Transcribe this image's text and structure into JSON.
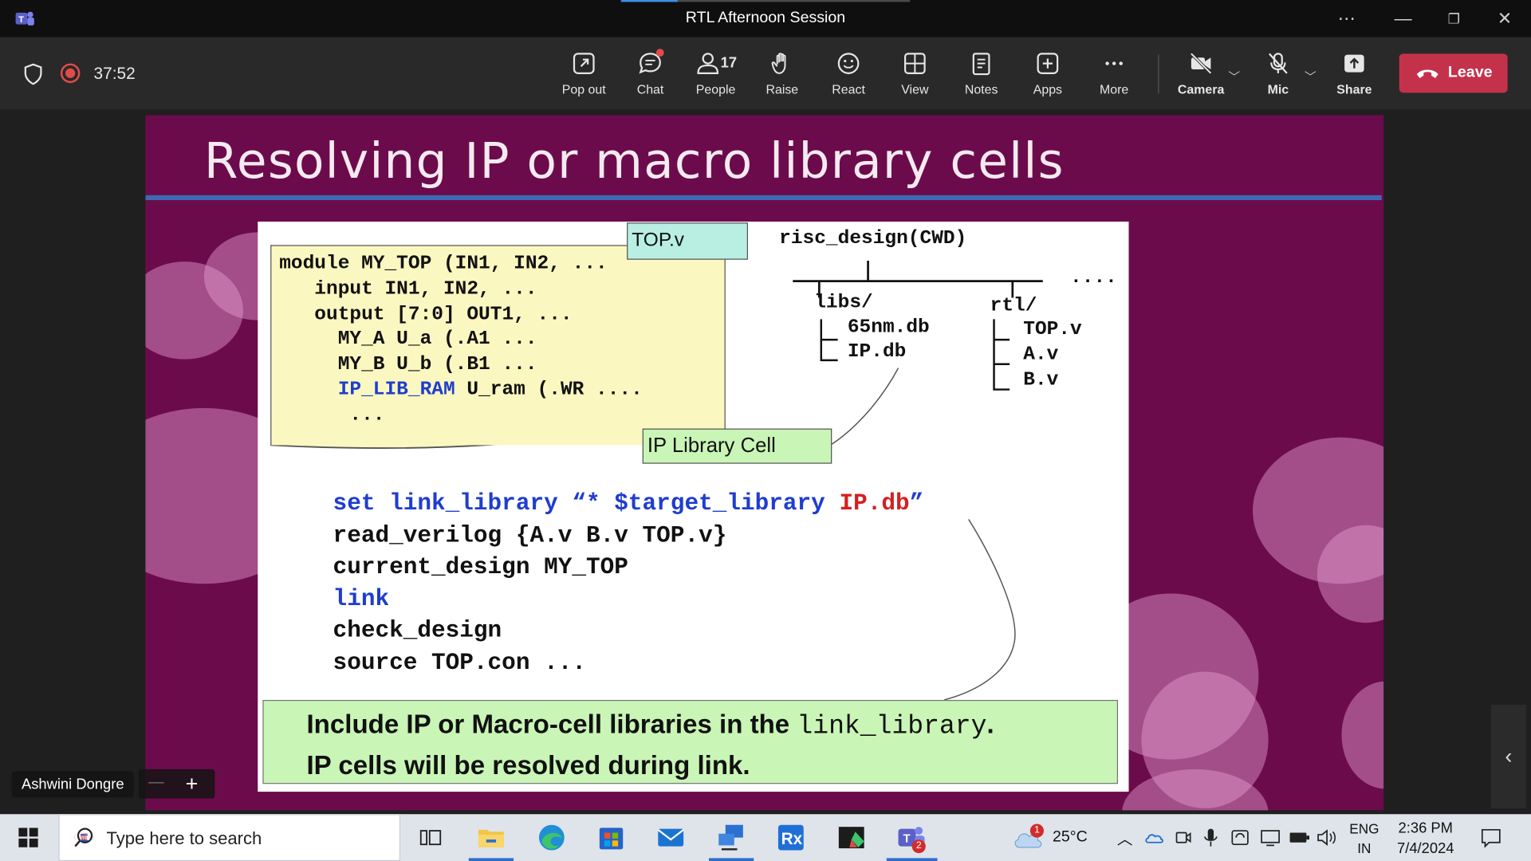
{
  "window": {
    "title": "RTL Afternoon Session"
  },
  "toolbar": {
    "timer": "37:52",
    "buttons": [
      {
        "label": "Pop out",
        "icon": "pop-out-icon"
      },
      {
        "label": "Chat",
        "icon": "chat-icon"
      },
      {
        "label": "People",
        "icon": "people-icon",
        "count": "17"
      },
      {
        "label": "Raise",
        "icon": "raise-hand-icon"
      },
      {
        "label": "React",
        "icon": "react-icon"
      },
      {
        "label": "View",
        "icon": "view-icon"
      },
      {
        "label": "Notes",
        "icon": "notes-icon"
      },
      {
        "label": "Apps",
        "icon": "apps-icon"
      },
      {
        "label": "More",
        "icon": "more-icon"
      },
      {
        "label": "Camera",
        "icon": "camera-off-icon"
      },
      {
        "label": "Mic",
        "icon": "mic-off-icon"
      },
      {
        "label": "Share",
        "icon": "share-icon"
      }
    ],
    "leave_label": "Leave",
    "leave_color": "#c4314b"
  },
  "slide": {
    "title": "Resolving IP or macro library cells",
    "file_label": "TOP.v",
    "code": {
      "l1": "module MY_TOP (IN1, IN2, ...",
      "l2": "   input IN1, IN2, ...",
      "l3": "   output [7:0] OUT1, ...",
      "l4a": "     MY_A U_a (.A1 ...",
      "l5": "     MY_B U_b (.B1 ...",
      "l6_blue": "IP_LIB_RAM",
      "l6_rest": " U_ram (.WR ....",
      "l7": "      ..."
    },
    "ip_cell_label": "IP Library Cell",
    "tree": {
      "root": "risc_design(CWD)",
      "dots": "....",
      "libs": "libs/",
      "rtl": "rtl/",
      "lib_files": [
        "65nm.db",
        "IP.db"
      ],
      "rtl_files": [
        "TOP.v",
        "A.v",
        "B.v"
      ]
    },
    "commands": {
      "c1_blue": "set link_library “* $target_library ",
      "c1_red": "IP.db",
      "c1_end": "”",
      "c2": "read_verilog {A.v B.v TOP.v}",
      "c3": "current_design MY_TOP",
      "c4": "link",
      "c5": "check_design",
      "c6": "source TOP.con ..."
    },
    "note": {
      "l1a": "Include IP or Macro-cell libraries in the ",
      "l1mono": "link_library",
      "l1b": ".",
      "l2": "IP cells will be resolved during link."
    }
  },
  "presenter": {
    "name": "Ashwini Dongre"
  },
  "zoom": {
    "minus": "—",
    "plus": "+"
  },
  "taskbar": {
    "search_placeholder": "Type here to search",
    "weather_temp": "25°C",
    "weather_badge": "1",
    "lang_top": "ENG",
    "lang_bottom": "IN",
    "time": "2:36 PM",
    "date": "7/4/2024",
    "teams_badge": "2"
  }
}
